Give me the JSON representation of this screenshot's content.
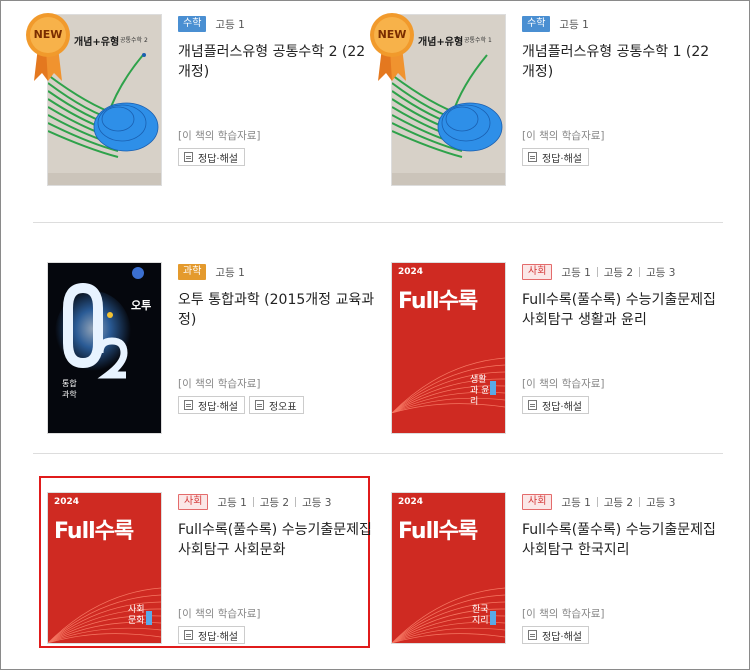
{
  "common": {
    "materials_label": "[이 책의 학습자료]",
    "answers_label": "정답·해설",
    "errata_label": "정오표",
    "new_badge": "NEW"
  },
  "books": [
    {
      "subject": "수학",
      "grades": [
        "고등 1"
      ],
      "title": "개념플러스유형 공통수학 2 (22 개정)",
      "cover_brand": "개념+유형",
      "cover_sub": "공통수학 2",
      "buttons": [
        "정답·해설"
      ],
      "is_new": true
    },
    {
      "subject": "수학",
      "grades": [
        "고등 1"
      ],
      "title": "개념플러스유형 공통수학 1 (22 개정)",
      "cover_brand": "개념+유형",
      "cover_sub": "공통수학 1",
      "buttons": [
        "정답·해설"
      ],
      "is_new": true
    },
    {
      "subject": "과학",
      "grades": [
        "고등 1"
      ],
      "title": "오투 통합과학 (2015개정 교육과정)",
      "cover_brand": "오투",
      "cover_sub": "통합과학",
      "buttons": [
        "정답·해설",
        "정오표"
      ],
      "is_new": false
    },
    {
      "subject": "사회",
      "grades": [
        "고등 1",
        "고등 2",
        "고등 3"
      ],
      "title": "Full수록(풀수록) 수능기출문제집 사회탐구 생활과 윤리",
      "cover_brand": "Full수록",
      "cover_sub": "생활과 윤리",
      "buttons": [
        "정답·해설"
      ],
      "is_new": false
    },
    {
      "subject": "사회",
      "grades": [
        "고등 1",
        "고등 2",
        "고등 3"
      ],
      "title": "Full수록(풀수록) 수능기출문제집 사회탐구 사회문화",
      "cover_brand": "Full수록",
      "cover_sub": "사회문화",
      "buttons": [
        "정답·해설"
      ],
      "is_new": false
    },
    {
      "subject": "사회",
      "grades": [
        "고등 1",
        "고등 2",
        "고등 3"
      ],
      "title": "Full수록(풀수록) 수능기출문제집 사회탐구 한국지리",
      "cover_brand": "Full수록",
      "cover_sub": "한국지리",
      "buttons": [
        "정답·해설"
      ],
      "is_new": false
    }
  ],
  "colors": {
    "math_tag": "#4a8fd2",
    "science_tag": "#e49a2d",
    "social_tag": "#d43a3a",
    "highlight": "#e01b1b"
  }
}
